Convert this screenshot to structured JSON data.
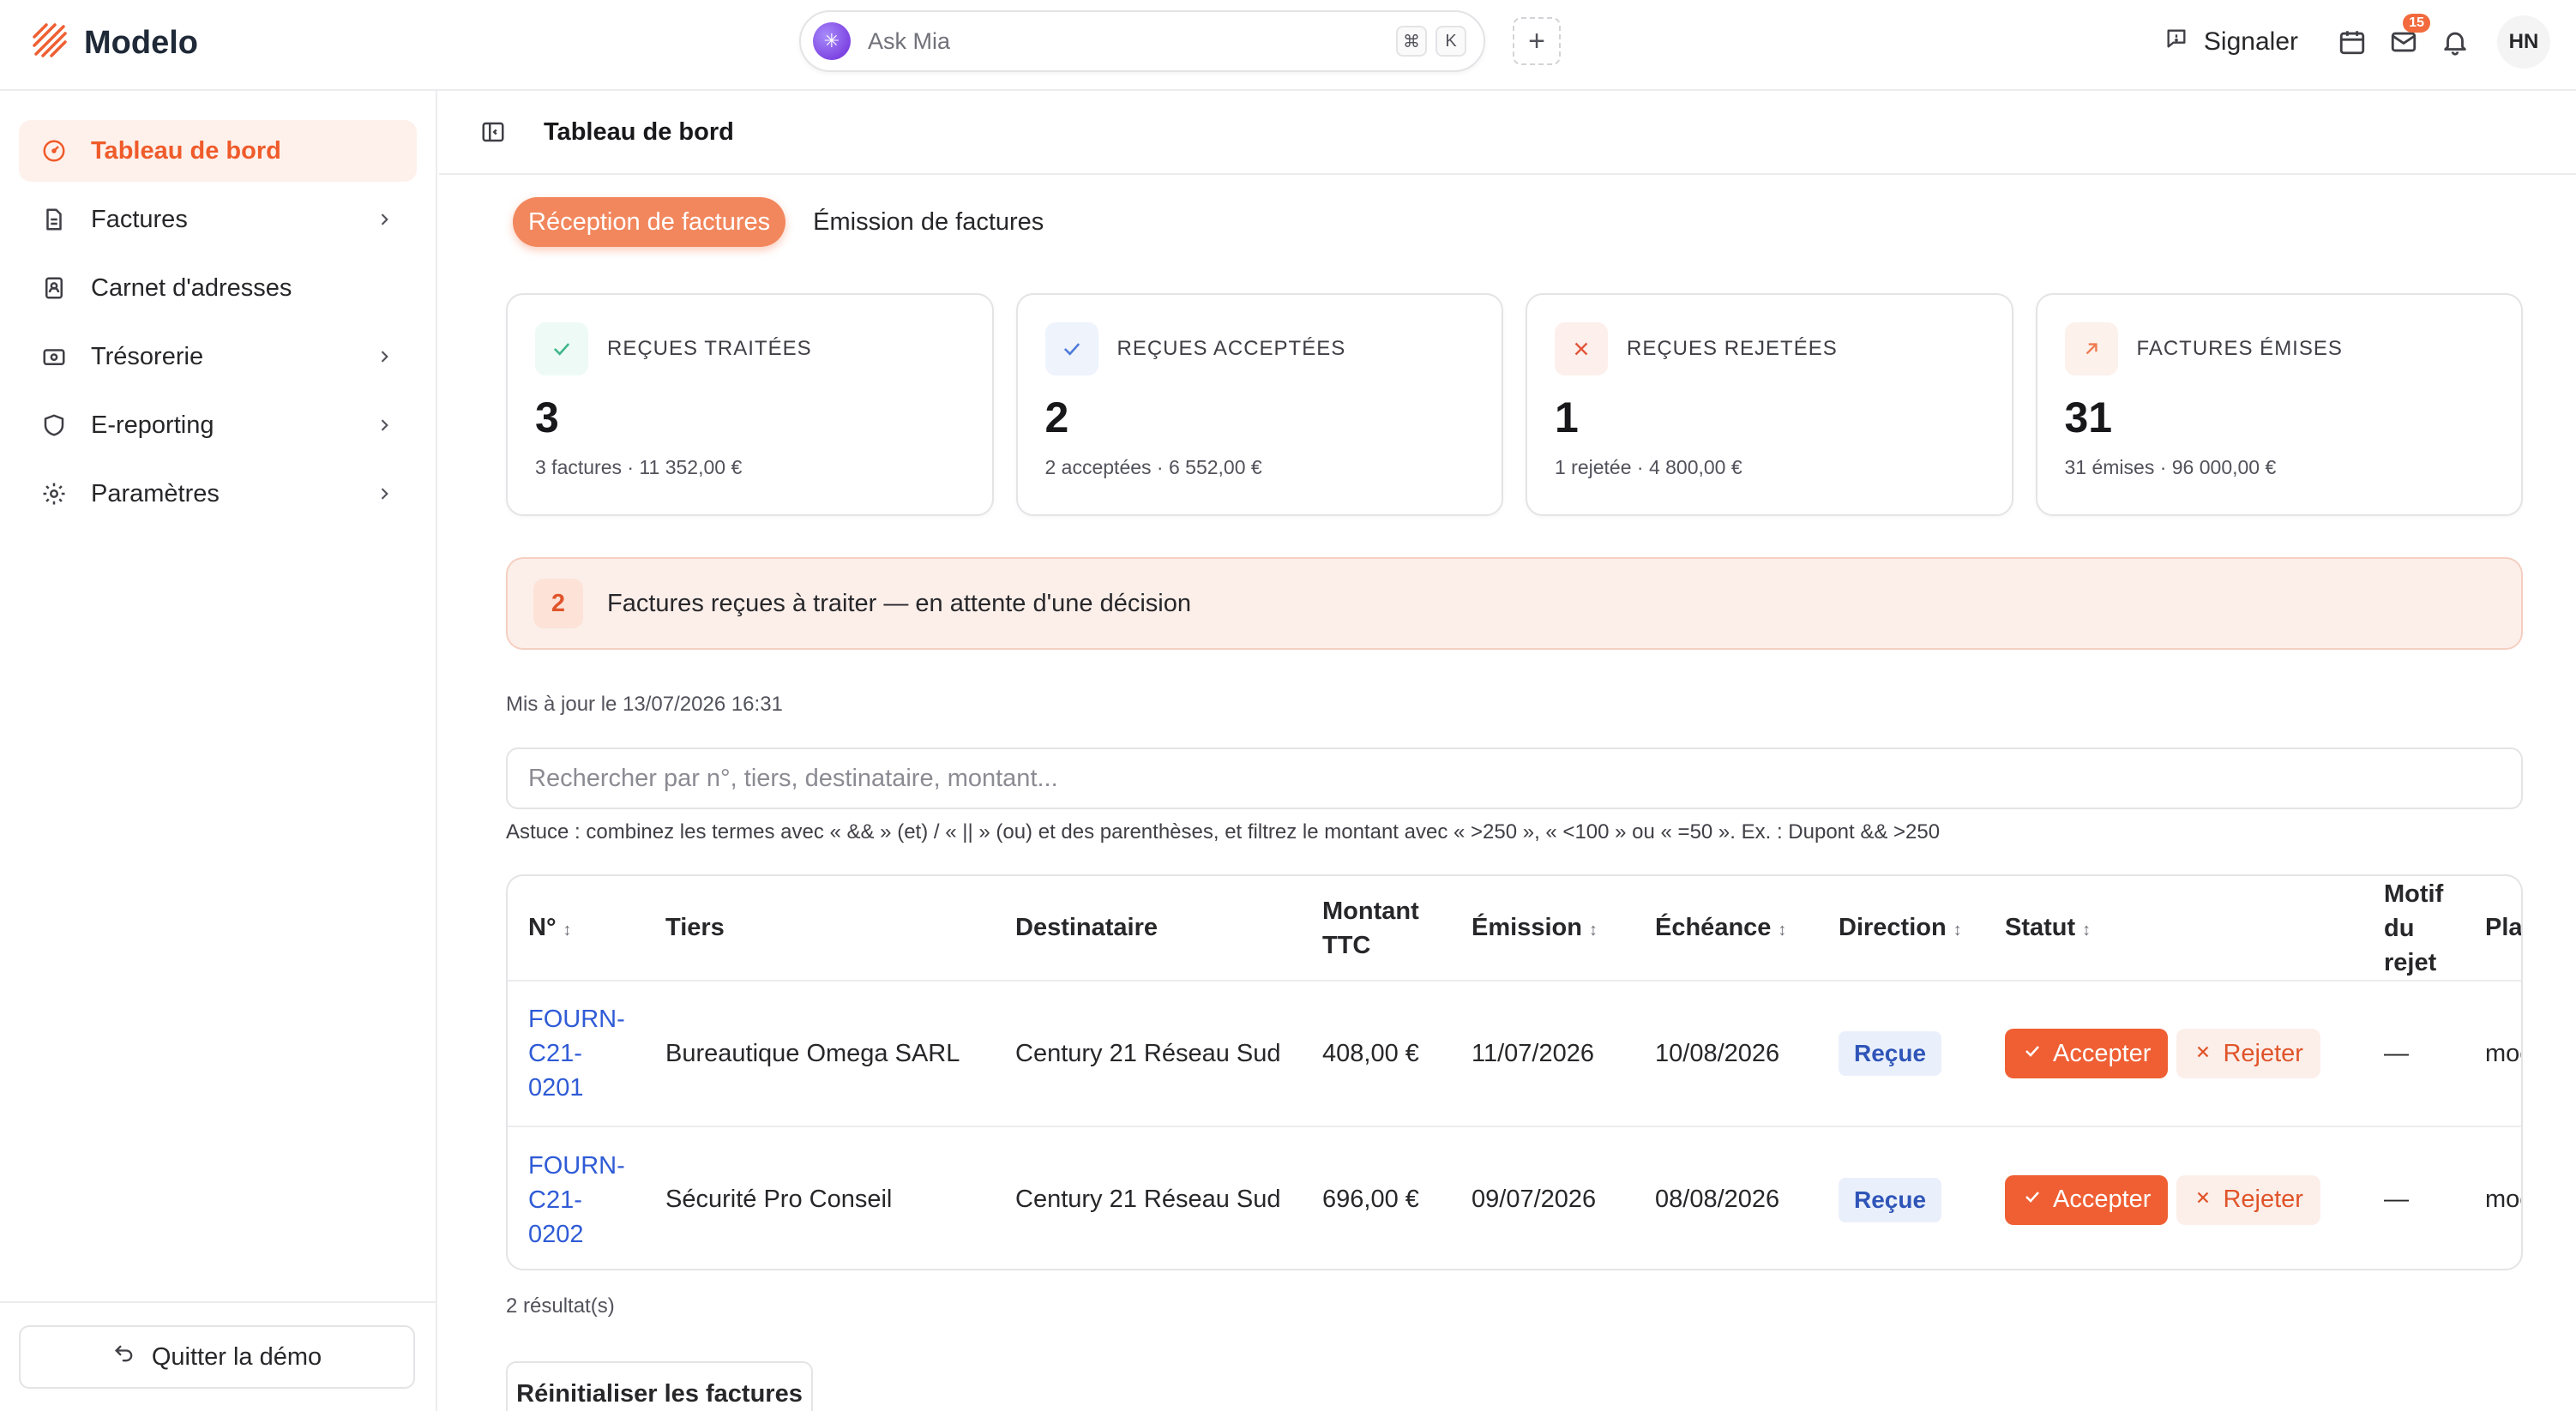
{
  "app": {
    "name": "Modelo"
  },
  "topbar": {
    "ask_placeholder": "Ask Mia",
    "shortcut_keys": [
      "⌘",
      "K"
    ],
    "plus_label": "+",
    "signaler_label": "Signaler",
    "mail_badge": "15",
    "user_initials": "HN"
  },
  "sidebar": {
    "items": [
      {
        "label": "Tableau de bord",
        "icon": "gauge-icon",
        "active": true,
        "chevron": false
      },
      {
        "label": "Factures",
        "icon": "file-text-icon",
        "active": false,
        "chevron": true
      },
      {
        "label": "Carnet d'adresses",
        "icon": "contacts-book-icon",
        "active": false,
        "chevron": false
      },
      {
        "label": "Trésorerie",
        "icon": "wallet-icon",
        "active": false,
        "chevron": true
      },
      {
        "label": "E-reporting",
        "icon": "shield-icon",
        "active": false,
        "chevron": true
      },
      {
        "label": "Paramètres",
        "icon": "gear-icon",
        "active": false,
        "chevron": true
      }
    ],
    "quit_label": "Quitter la démo"
  },
  "header": {
    "title": "Tableau de bord"
  },
  "tabs": [
    {
      "label": "Réception de factures",
      "active": true
    },
    {
      "label": "Émission de factures",
      "active": false
    }
  ],
  "cards": [
    {
      "label": "REÇUES TRAITÉES",
      "value": "3",
      "sub": "3 factures · 11 352,00 €",
      "icon": "check-icon",
      "icon_color": "#3fb68b",
      "icon_bg": "#eefaf5"
    },
    {
      "label": "REÇUES ACCEPTÉES",
      "value": "2",
      "sub": "2 acceptées · 6 552,00 €",
      "icon": "check-icon",
      "icon_color": "#4f7bd9",
      "icon_bg": "#eef3fc"
    },
    {
      "label": "REÇUES REJETÉES",
      "value": "1",
      "sub": "1 rejetée · 4 800,00 €",
      "icon": "close-icon",
      "icon_color": "#e2563b",
      "icon_bg": "#fdf0ec"
    },
    {
      "label": "FACTURES ÉMISES",
      "value": "31",
      "sub": "31 émises · 96 000,00 €",
      "icon": "arrow-up-right-icon",
      "icon_color": "#ef7a4f",
      "icon_bg": "#fdf1ec"
    }
  ],
  "alert": {
    "count": "2",
    "text": "Factures reçues à traiter — en attente d'une décision"
  },
  "updated_text": "Mis à jour le 13/07/2026 16:31",
  "search": {
    "placeholder": "Rechercher par n°, tiers, destinataire, montant..."
  },
  "tip": "Astuce : combinez les termes avec « && » (et) / « || » (ou) et des parenthèses, et filtrez le montant avec « >250 », « <100 » ou « =50 ». Ex. : Dupont && >250",
  "table": {
    "columns": [
      {
        "label": "N°",
        "sortable": true
      },
      {
        "label": "Tiers",
        "sortable": false
      },
      {
        "label": "Destinataire",
        "sortable": false
      },
      {
        "label": "Montant TTC",
        "sortable": false
      },
      {
        "label": "Émission",
        "sortable": true
      },
      {
        "label": "Échéance",
        "sortable": true
      },
      {
        "label": "Direction",
        "sortable": true
      },
      {
        "label": "Statut",
        "sortable": true
      },
      {
        "label": "Motif du rejet",
        "sortable": false
      },
      {
        "label": "Plateforme",
        "sortable": false
      }
    ],
    "rows": [
      {
        "number": "FOURN-C21-0201",
        "number_lines": [
          "FOURN-",
          "C21-",
          "0201"
        ],
        "tiers": "Bureautique Omega SARL",
        "destinataire": "Century 21 Réseau Sud",
        "montant": "408,00 €",
        "emission": "11/07/2026",
        "echeance": "10/08/2026",
        "direction": "Reçue",
        "motif": "—",
        "plateforme": "mock"
      },
      {
        "number": "FOURN-C21-0202",
        "number_lines": [
          "FOURN-",
          "C21-",
          "0202"
        ],
        "tiers": "Sécurité Pro Conseil",
        "destinataire": "Century 21 Réseau Sud",
        "montant": "696,00 €",
        "emission": "09/07/2026",
        "echeance": "08/08/2026",
        "direction": "Reçue",
        "motif": "—",
        "plateforme": "mock"
      }
    ],
    "accept_label": "Accepter",
    "reject_label": "Rejeter"
  },
  "results_text": "2 résultat(s)",
  "reset_label": "Réinitialiser les factures",
  "colors": {
    "accent": "#ef5f33",
    "accent_soft": "#fef1ec",
    "link": "#2f5bd6"
  }
}
